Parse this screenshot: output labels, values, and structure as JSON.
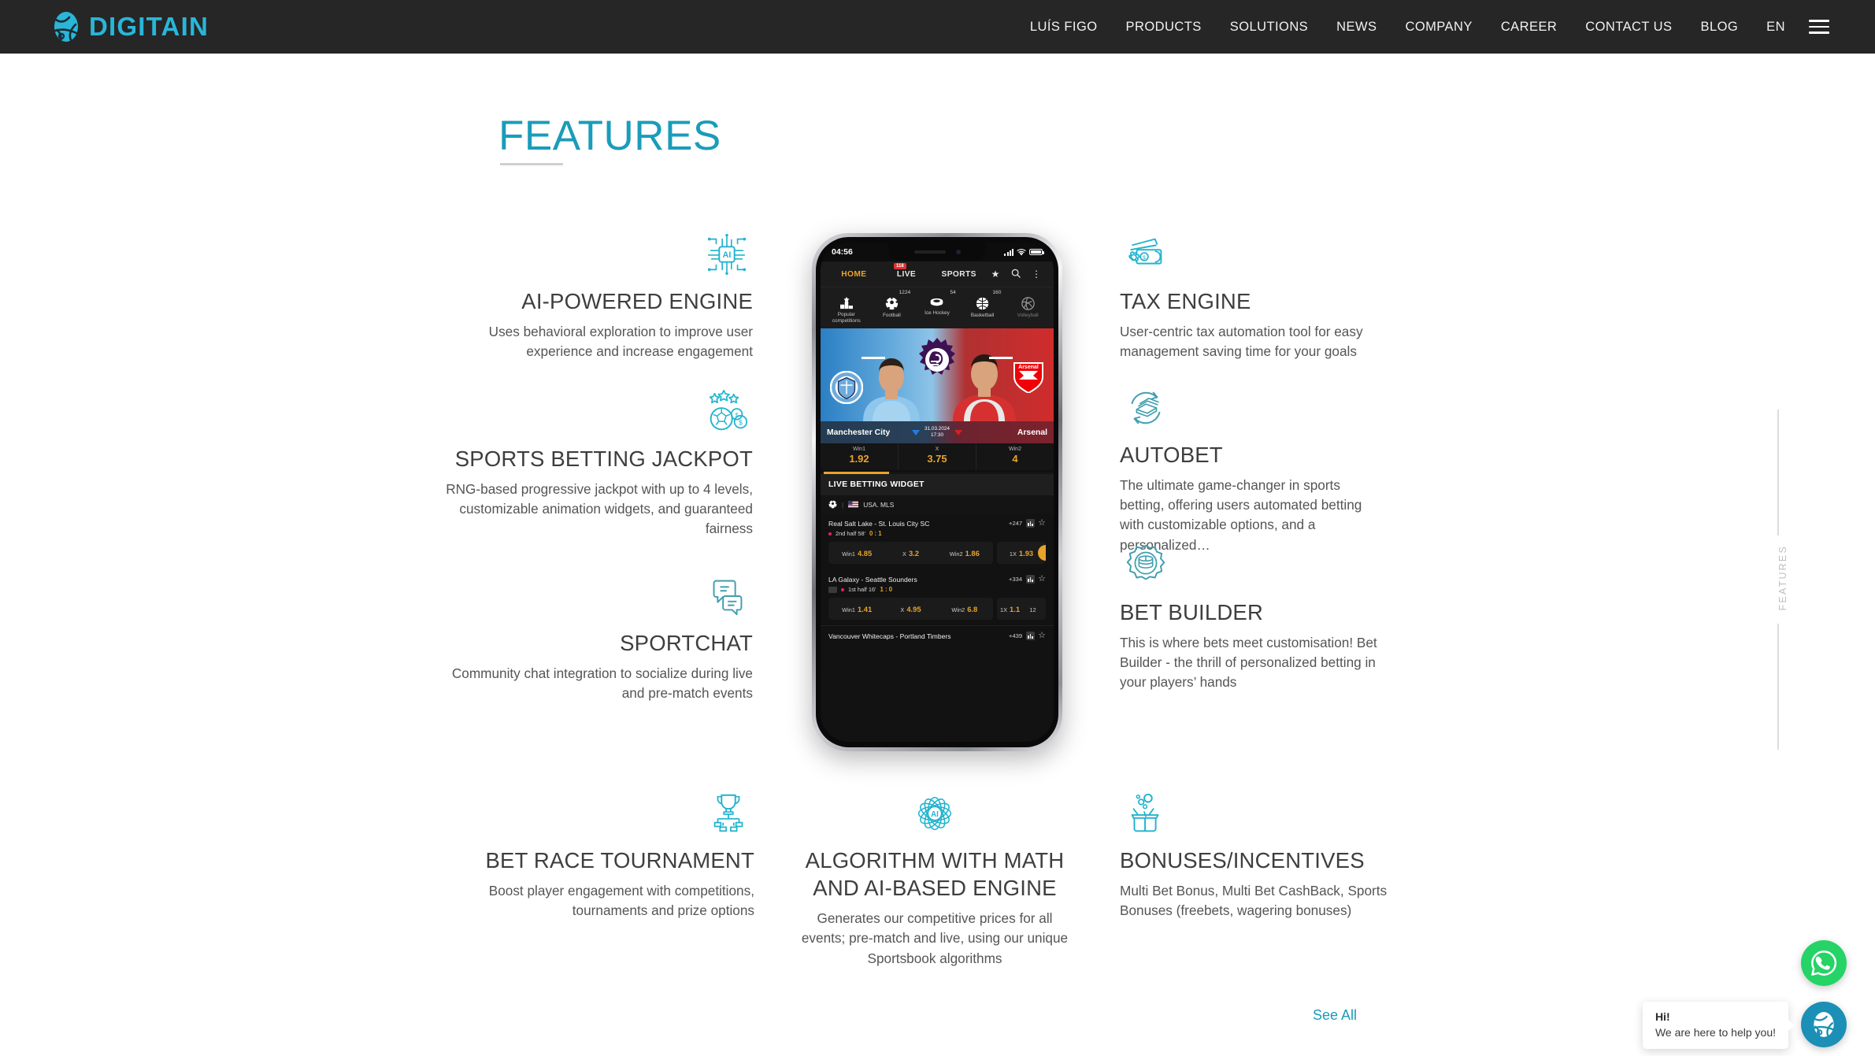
{
  "header": {
    "logo_text": "DIGITAIN",
    "logo_icon": "digitain-globe-logo",
    "nav": [
      {
        "label": "LUÍS FIGO",
        "name": "nav-item-luis-figo"
      },
      {
        "label": "PRODUCTS",
        "name": "nav-item-products"
      },
      {
        "label": "SOLUTIONS",
        "name": "nav-item-solutions"
      },
      {
        "label": "NEWS",
        "name": "nav-item-news"
      },
      {
        "label": "COMPANY",
        "name": "nav-item-company"
      },
      {
        "label": "CAREER",
        "name": "nav-item-career"
      },
      {
        "label": "CONTACT US",
        "name": "nav-item-contact-us"
      },
      {
        "label": "BLOG",
        "name": "nav-item-blog"
      }
    ],
    "language": "EN",
    "menu_icon": "hamburger-menu-icon",
    "bg_color": "#262626"
  },
  "section": {
    "title": "FEATURES",
    "accent_color": "#1a9cba",
    "see_all": "See All",
    "rail_label": "FEATURES"
  },
  "features": {
    "ai_powered": {
      "icon": "ai-chip-icon",
      "title": "AI-POWERED ENGINE",
      "desc": "Uses behavioral exploration to improve user experience and increase engagement"
    },
    "jackpot": {
      "icon": "football-jackpot-coins-icon",
      "title": "SPORTS BETTING JACKPOT",
      "desc": "RNG-based progressive jackpot with up to 4 levels, customizable animation widgets, and guaranteed fairness"
    },
    "sportchat": {
      "icon": "chat-bubbles-icon",
      "title": "SPORTCHAT",
      "desc": "Community chat integration to socialize during live and pre-match events"
    },
    "tax_engine": {
      "icon": "money-gear-icon",
      "title": "TAX ENGINE",
      "desc": "User-centric tax automation tool for easy management saving time for your goals"
    },
    "autobet": {
      "icon": "cash-refresh-icon",
      "title": "AUTOBET",
      "desc": "The ultimate game-changer in sports betting, offering users automated betting with customizable options, and a personalized…"
    },
    "bet_builder": {
      "icon": "coin-stack-gear-icon",
      "title": "BET BUILDER",
      "desc": "This is where bets meet customisation! Bet Builder - the thrill of personalized betting in your players’ hands"
    },
    "bet_race": {
      "icon": "trophy-bracket-icon",
      "title": "BET RACE TOURNAMENT",
      "desc": "Boost player engagement with competitions, tournaments and prize options"
    },
    "algorithm": {
      "icon": "ai-atom-icon",
      "title": "ALGORITHM WITH MATH AND AI-BASED ENGINE",
      "desc": "Generates our competitive prices for all events; pre-match and live, using our unique Sportsbook algorithms"
    },
    "bonuses": {
      "icon": "gift-box-icon",
      "title": "BONUSES/INCENTIVES",
      "desc": "Multi Bet Bonus, Multi Bet CashBack, Sports Bonuses (freebets, wagering bonuses)"
    }
  },
  "phone": {
    "status": {
      "time": "04:56",
      "signal_icon": "signal-bars-icon",
      "wifi_icon": "wifi-icon",
      "battery_icon": "battery-full-icon"
    },
    "tabs": [
      {
        "label": "HOME",
        "active": true
      },
      {
        "label": "LIVE",
        "active": false,
        "badge": "118"
      },
      {
        "label": "SPORTS",
        "active": false
      }
    ],
    "tab_icons": [
      "star-icon",
      "search-icon",
      "more-vertical-icon"
    ],
    "sports": [
      {
        "name": "Popular competitions",
        "count": "",
        "icon": "podium-icon"
      },
      {
        "name": "Football",
        "count": "1224",
        "icon": "football-icon"
      },
      {
        "name": "Ice Hockey",
        "count": "54",
        "icon": "ice-hockey-puck-icon"
      },
      {
        "name": "Basketball",
        "count": "160",
        "icon": "basketball-icon"
      },
      {
        "name": "Volleyball",
        "count": "",
        "icon": "volleyball-icon"
      }
    ],
    "banner": {
      "league_icon": "premier-league-crest",
      "home": "Manchester City",
      "away": "Arsenal",
      "date": "31.03.2024",
      "time": "17:30"
    },
    "main_odds": [
      {
        "label": "Win1",
        "value": "1.92"
      },
      {
        "label": "X",
        "value": "3.75"
      },
      {
        "label": "Win2",
        "value": "4"
      }
    ],
    "widget_title": "LIVE BETTING WIDGET",
    "league": {
      "sport_icon": "football-icon",
      "flag": "us-flag-icon",
      "name": "USA. MLS"
    },
    "events": [
      {
        "name": "Real Salt Lake - St. Louis City SC",
        "count": "+247",
        "period": "2nd half 58'",
        "score": "0 : 1",
        "has_tv": false,
        "markets": [
          {
            "key": "Win1",
            "value": "4.85"
          },
          {
            "key": "X",
            "value": "3.2"
          },
          {
            "key": "Win2",
            "value": "1.86"
          }
        ],
        "side_markets": [
          {
            "key": "1X",
            "value": "1.93"
          }
        ]
      },
      {
        "name": "LA Galaxy - Seattle Sounders",
        "count": "+334",
        "period": "1st half 16'",
        "score": "1 : 0",
        "has_tv": true,
        "markets": [
          {
            "key": "Win1",
            "value": "1.41"
          },
          {
            "key": "X",
            "value": "4.95"
          },
          {
            "key": "Win2",
            "value": "6.8"
          }
        ],
        "side_markets": [
          {
            "key": "1X",
            "value": "1.1"
          },
          {
            "key": "12",
            "value": ""
          }
        ]
      },
      {
        "name": "Vancouver Whitecaps - Portland Timbers",
        "count": "+439",
        "period": "",
        "score": "",
        "has_tv": false,
        "markets": [],
        "side_markets": []
      }
    ]
  },
  "widgets": {
    "whatsapp_icon": "whatsapp-icon",
    "digitain_chat_icon": "digitain-globe-icon",
    "bubble_line1": "Hi!",
    "bubble_line2": "We are here to help you!",
    "whatsapp_color": "#25D366",
    "digitain_color": "#1b8fb5"
  }
}
